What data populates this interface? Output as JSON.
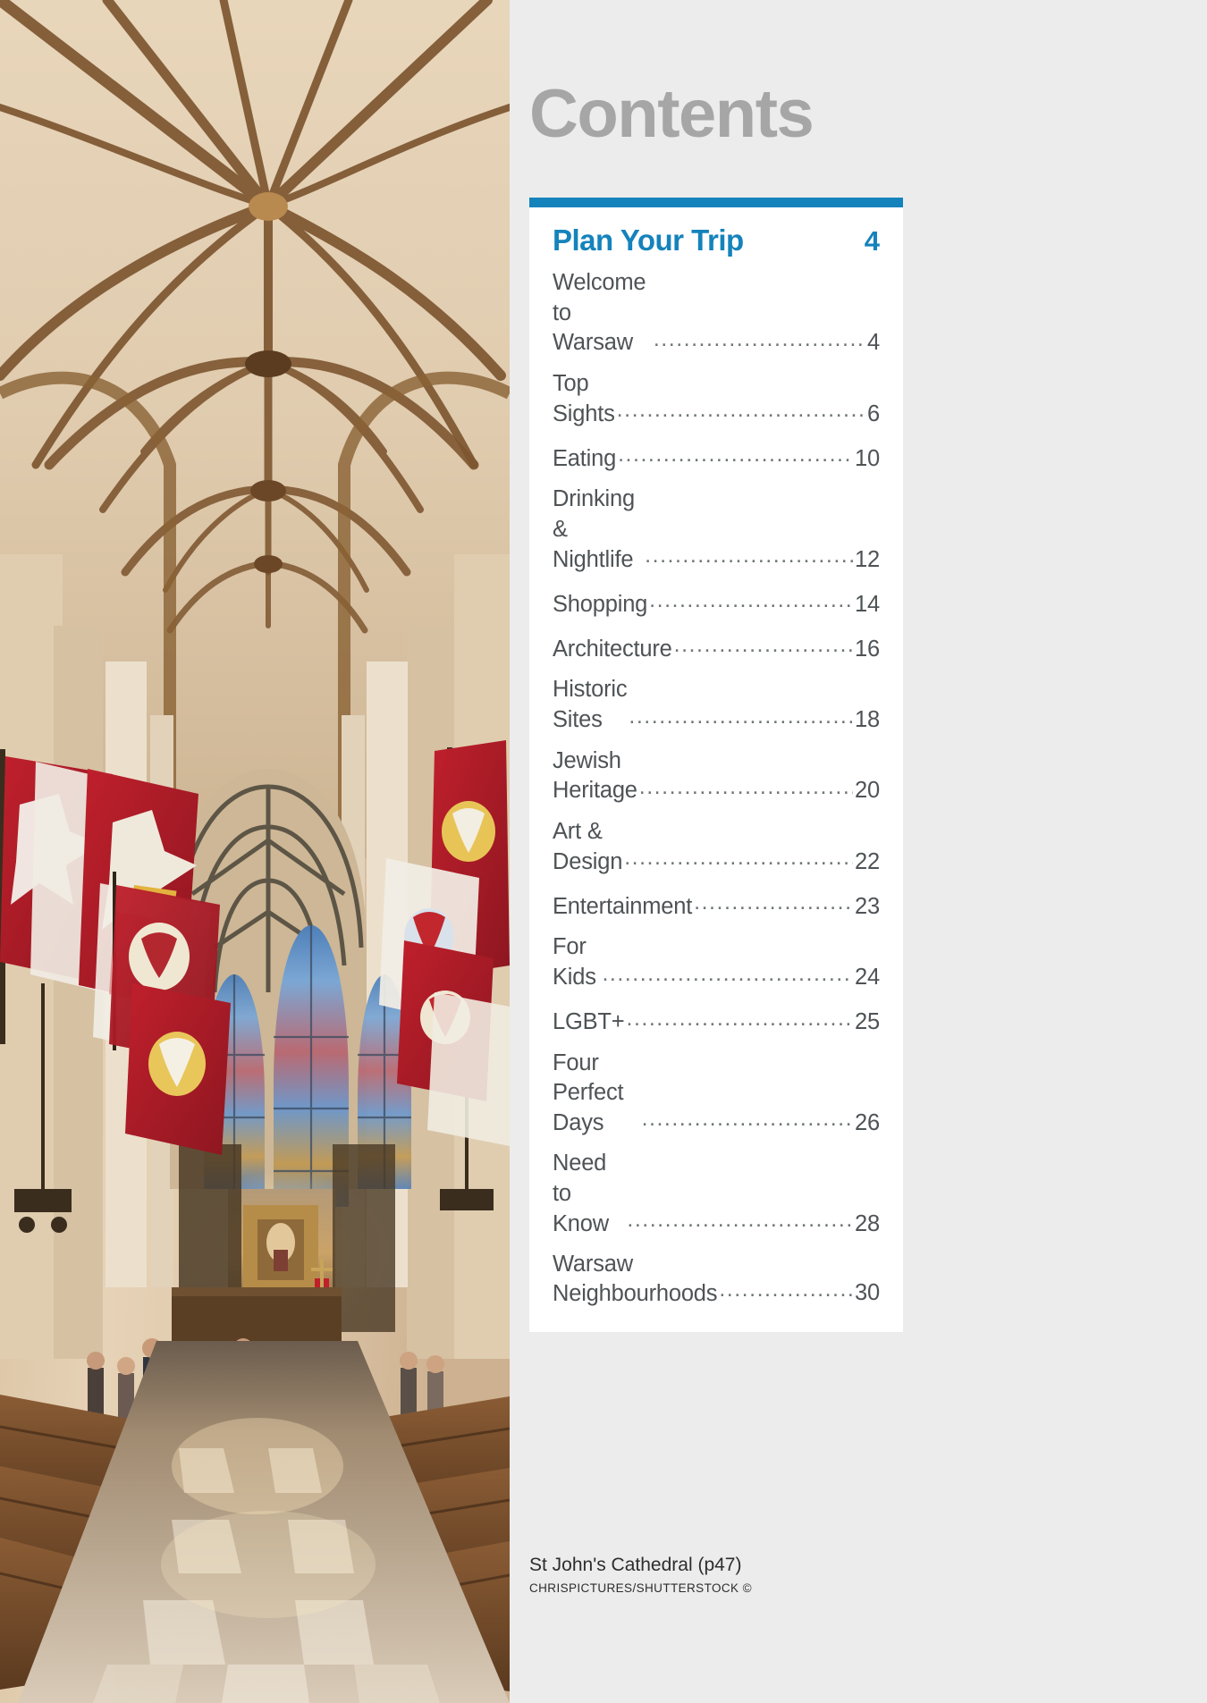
{
  "page": {
    "background_color": "#ececec",
    "accent_color": "#1583bb",
    "heading_color": "#a6a6a6",
    "text_color": "#4e5356"
  },
  "header": {
    "title": "Contents"
  },
  "toc": {
    "section_label": "Plan Your Trip",
    "section_page": "4",
    "entries": [
      {
        "label": "Welcome to Warsaw",
        "page": "4"
      },
      {
        "label": "Top Sights",
        "page": "6"
      },
      {
        "label": "Eating",
        "page": "10"
      },
      {
        "label": "Drinking & Nightlife",
        "page": "12"
      },
      {
        "label": "Shopping",
        "page": "14"
      },
      {
        "label": "Architecture",
        "page": "16"
      },
      {
        "label": "Historic Sites",
        "page": "18"
      },
      {
        "label": "Jewish Heritage",
        "page": "20"
      },
      {
        "label": "Art & Design",
        "page": "22"
      },
      {
        "label": "Entertainment",
        "page": "23"
      },
      {
        "label": "For Kids",
        "page": "24"
      },
      {
        "label": "LGBT+",
        "page": "25"
      },
      {
        "label": "Four Perfect Days",
        "page": "26"
      },
      {
        "label": "Need to Know",
        "page": "28"
      },
      {
        "label": "Warsaw\nNeighbourhoods",
        "page": "30"
      }
    ]
  },
  "photo": {
    "caption": "St John's Cathedral (p47)",
    "credit": "CHRISPICTURES/SHUTTERSTOCK ©",
    "subject": "cathedral-interior-nave-with-flags"
  }
}
